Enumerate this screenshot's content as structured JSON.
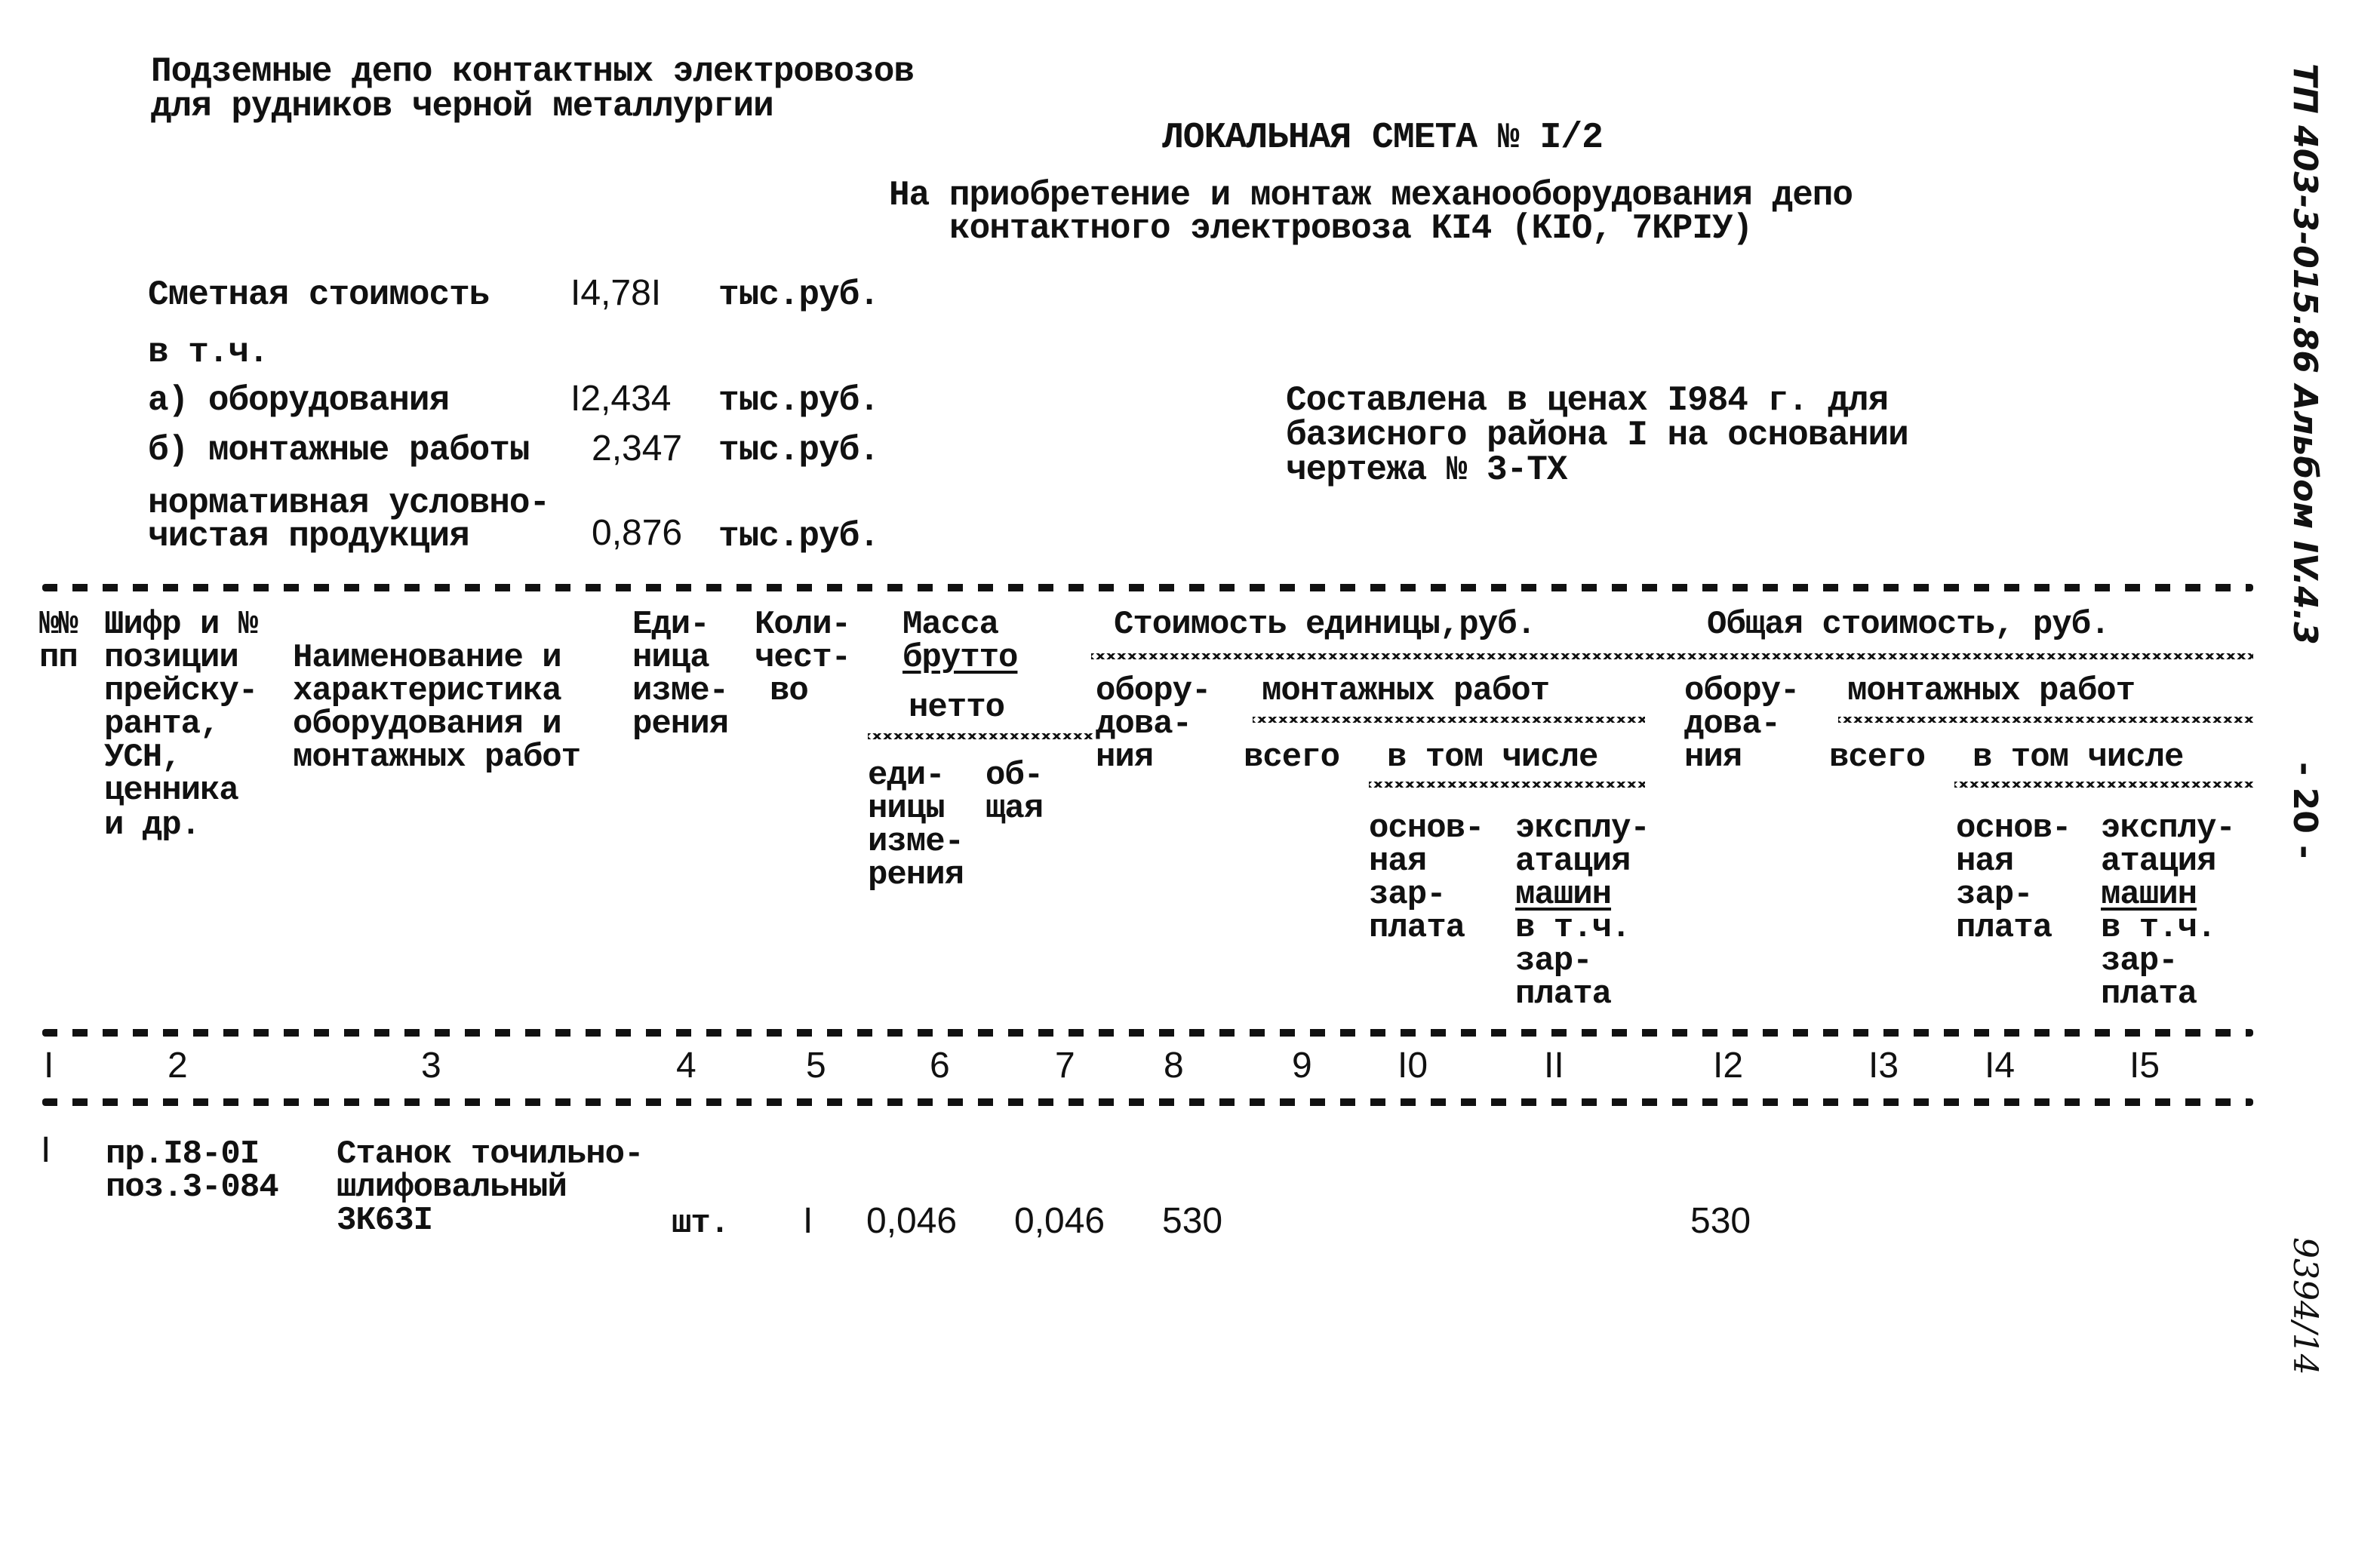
{
  "header": {
    "org_line1": "Подземные депо контактных электровозов",
    "org_line2": "для рудников черной металлургии",
    "title": "ЛОКАЛЬНАЯ СМЕТА № I/2",
    "subtitle_line1": "На приобретение и монтаж механооборудования депо",
    "subtitle_line2": "контактного электровоза КI4 (КIО, 7КРIУ)"
  },
  "summary": {
    "total_label": "Сметная стоимость",
    "total_value": "I4,78I",
    "unit": "тыс.руб.",
    "incl_label": "в т.ч.",
    "equipment_label": "а) оборудования",
    "equipment_value": "I2,434",
    "installation_label": "б) монтажные работы",
    "installation_value": "2,347",
    "net_label_line1": "нормативная условно-",
    "net_label_line2": "чистая продукция",
    "net_value": "0,876"
  },
  "pricing_note": {
    "line1": "Составлена в ценах I984 г. для",
    "line2": "базисного района I на основании",
    "line3": "чертежа № 3-ТХ"
  },
  "side_margin": {
    "album_code": "ТП 403-3-015.86 Альбом IV.4.3",
    "page_number": "- 20 -",
    "inventory_number": "9394/14"
  },
  "table": {
    "headers": {
      "col1": [
        "№№",
        "пп"
      ],
      "col2": [
        "Шифр и №",
        "позиции",
        "прейску-",
        "ранта,",
        "УСН,",
        "ценника",
        "и др."
      ],
      "col3": [
        "Наименование и",
        "характеристика",
        "оборудования и",
        "монтажных работ"
      ],
      "col4": [
        "Еди-",
        "ница",
        "изме-",
        "рения"
      ],
      "col5": [
        "Коли-",
        "чест-",
        "во"
      ],
      "mass_group": [
        "Масса",
        "брутто",
        "нетто"
      ],
      "mass_unit": [
        "еди-",
        "ницы",
        "изме-",
        "рения"
      ],
      "mass_total": [
        "об-",
        "щая"
      ],
      "unit_cost_group": "Стоимость единицы,руб.",
      "total_cost_group": "Общая стоимость, руб.",
      "equipment": [
        "обору-",
        "дова-",
        "ния"
      ],
      "installation_group": "монтажных работ",
      "total_sub": "всего",
      "incl_group": "в том числе",
      "base_wage": [
        "основ-",
        "ная",
        "зар-",
        "плата"
      ],
      "machine_op": [
        "эксплу-",
        "атация",
        "машин",
        "в т.ч.",
        "зар-",
        "плата"
      ]
    },
    "column_numbers": [
      "I",
      "2",
      "3",
      "4",
      "5",
      "6",
      "7",
      "8",
      "9",
      "I0",
      "II",
      "I2",
      "I3",
      "I4",
      "I5"
    ],
    "rows": [
      {
        "no": "I",
        "code_line1": "пр.I8-0I",
        "code_line2": "поз.3-084",
        "name_line1": "Станок точильно-",
        "name_line2": "шлифовальный",
        "name_line3": "3К63I",
        "unit": "шт.",
        "qty": "I",
        "mass_unit": "0,046",
        "mass_total": "0,046",
        "unit_equipment": "530",
        "unit_install_total": "",
        "unit_base_wage": "",
        "unit_machine_op": "",
        "total_equipment": "530",
        "total_install_total": "",
        "total_base_wage": "",
        "total_machine_op": ""
      }
    ]
  }
}
